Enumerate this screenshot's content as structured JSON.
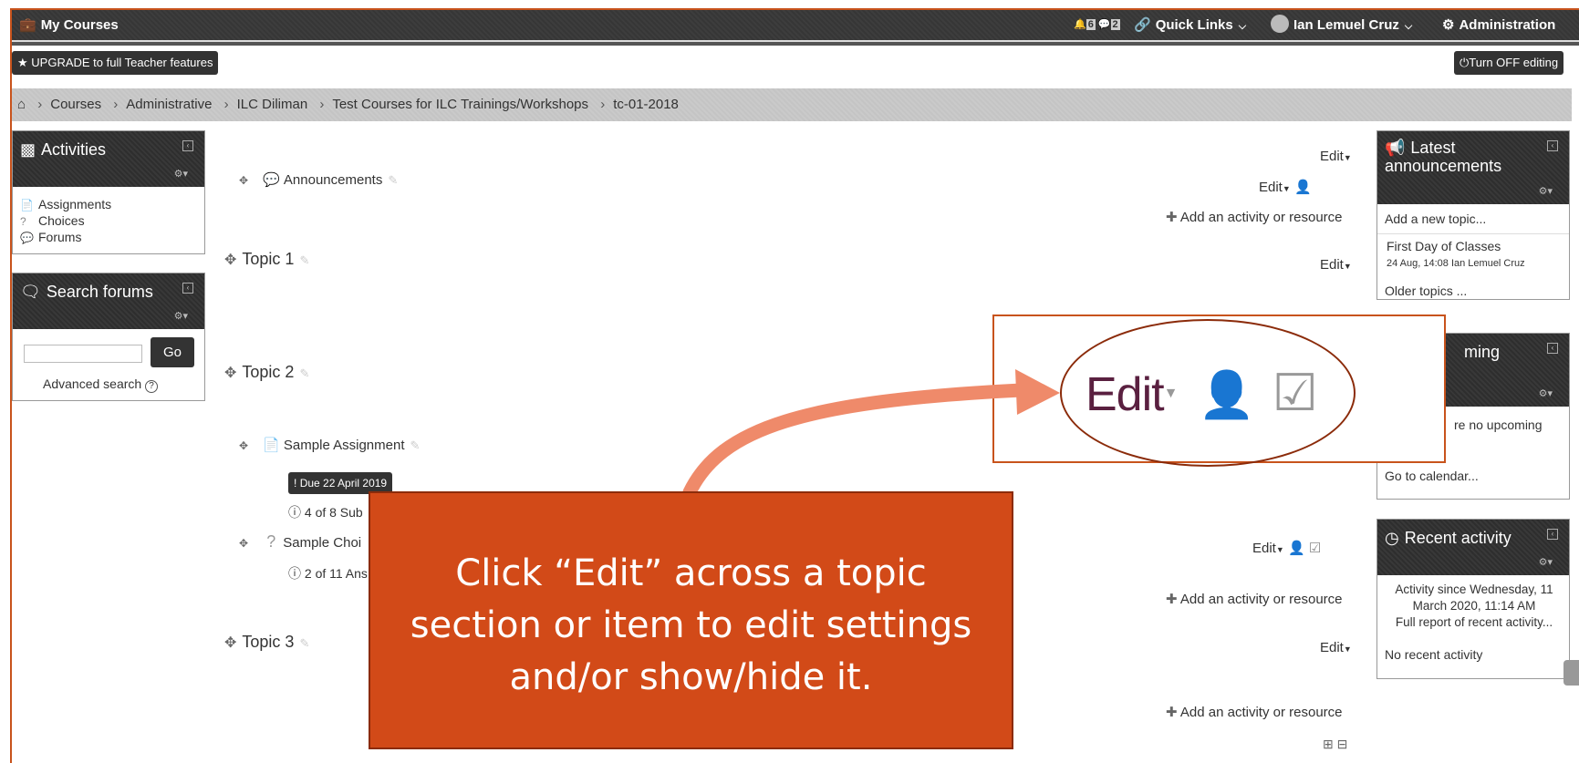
{
  "navbar": {
    "my_courses": "My Courses",
    "notif_count": "6",
    "msg_count": "2",
    "quick_links": "Quick Links",
    "user_name": "Ian Lemuel Cruz",
    "administration": "Administration"
  },
  "toolbar": {
    "upgrade": "UPGRADE to full Teacher features",
    "turn_off_editing": "Turn OFF editing"
  },
  "breadcrumb": [
    "Courses",
    "Administrative",
    "ILC Diliman",
    "Test Courses for ILC Trainings/Workshops",
    "tc-01-2018"
  ],
  "activities_block": {
    "title": "Activities",
    "items": [
      "Assignments",
      "Choices",
      "Forums"
    ]
  },
  "search_block": {
    "title": "Search forums",
    "go": "Go",
    "advanced": "Advanced search"
  },
  "main": {
    "edit": "Edit",
    "announcements": "Announcements",
    "add_activity": "Add an activity or resource",
    "topic1": "Topic 1",
    "topic2": "Topic 2",
    "topic3": "Topic 3",
    "sample_assignment": "Sample Assignment",
    "due_badge": "Due 22 April 2019",
    "submissions": "4 of 8 Sub",
    "sample_choice": "Sample Choi",
    "answers": "2 of 11 Ans"
  },
  "announce_block": {
    "title": "Latest announcements",
    "add_topic": "Add a new topic...",
    "post_title": "First Day of Classes",
    "post_meta": "24 Aug, 14:08  Ian Lemuel Cruz",
    "older": "Older topics ..."
  },
  "upcoming_block": {
    "title_visible": "ming",
    "body_visible": "re no upcoming",
    "calendar": "Go to calendar..."
  },
  "recent_block": {
    "title": "Recent activity",
    "since": "Activity since Wednesday, 11 March 2020, 11:14 AM",
    "full_report": "Full report of recent activity...",
    "none": "No recent activity"
  },
  "callout": {
    "zoom_edit": "Edit",
    "instruction": "Click “Edit” across a topic section or item to edit settings and/or show/hide it."
  },
  "colors": {
    "accent": "#d24a18",
    "accent_dark": "#8b2b0a",
    "navbar": "#3a3a3a"
  }
}
